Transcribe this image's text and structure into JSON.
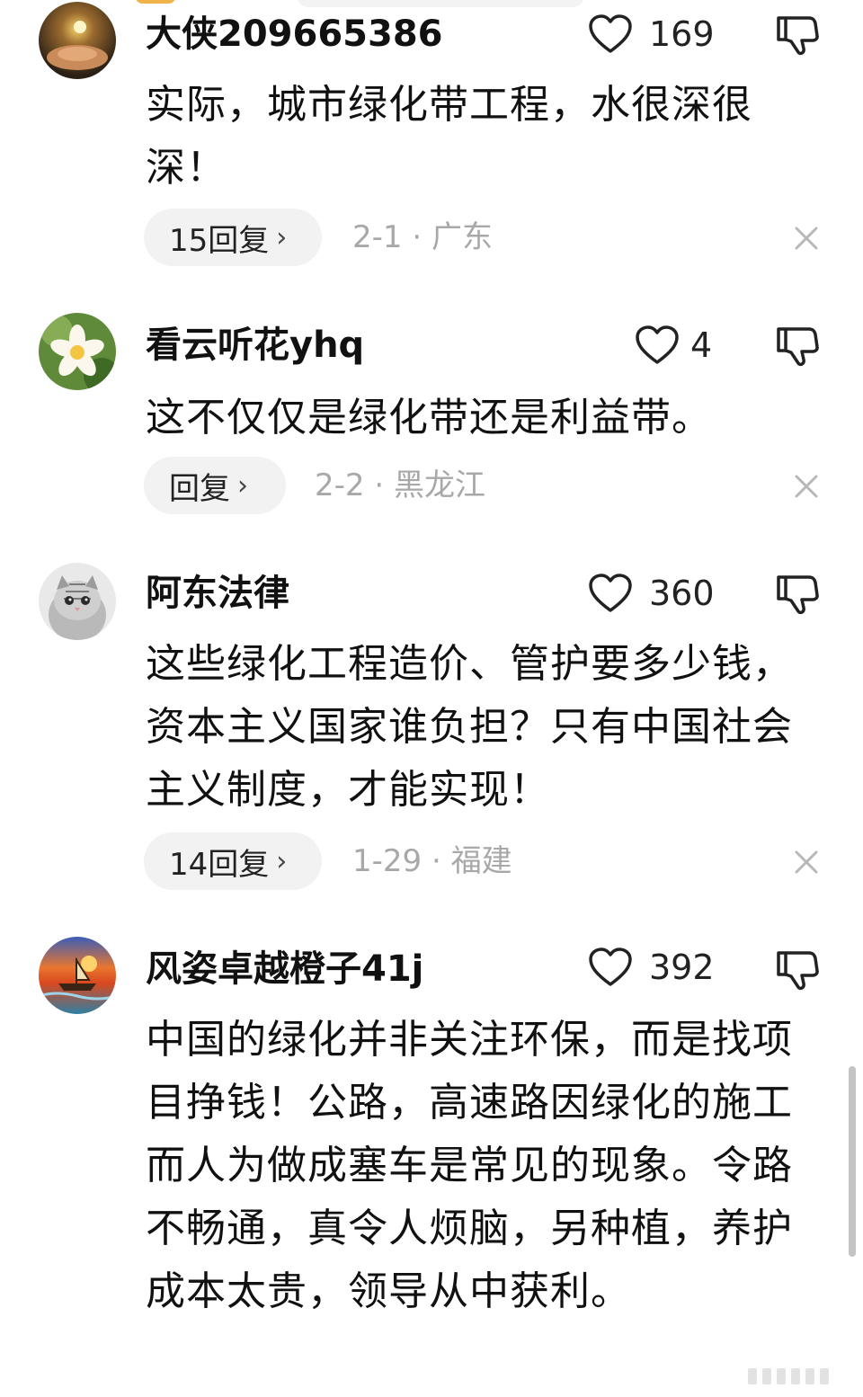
{
  "comments": [
    {
      "username": "大侠209665386",
      "like_count": "169",
      "content": "实际，城市绿化带工程，水很深很深！",
      "reply_label": "15回复",
      "meta": "2-1 · 广东",
      "avatar": "hands-light-avatar"
    },
    {
      "username": "看云听花yhq",
      "like_count": "4",
      "content": "这不仅仅是绿化带还是利益带。",
      "reply_label": "回复",
      "meta": "2-2 · 黑龙江",
      "avatar": "flower-avatar"
    },
    {
      "username": "阿东法律",
      "like_count": "360",
      "content": "这些绿化工程造价、管护要多少钱，资本主义国家谁负担？只有中国社会主义制度，才能实现！",
      "reply_label": "14回复",
      "meta": "1-29 · 福建",
      "avatar": "cat-avatar"
    },
    {
      "username": "风姿卓越橙子41j",
      "like_count": "392",
      "content": "中国的绿化并非关注环保，而是找项目挣钱！公路，高速路因绿化的施工而人为做成塞车是常见的现象。令路不畅通，真令人烦脑，另种植，养护成本太贵，领导从中获利。",
      "avatar": "sunset-boat-avatar"
    }
  ],
  "icons": {
    "like": "heart-outline-icon",
    "dislike": "thumbs-down-icon",
    "reply_arrow": "chevron-right-icon",
    "dismiss": "close-icon"
  },
  "colors": {
    "text": "#111111",
    "meta": "#a8a8a8",
    "pill": "#f2f2f2"
  }
}
